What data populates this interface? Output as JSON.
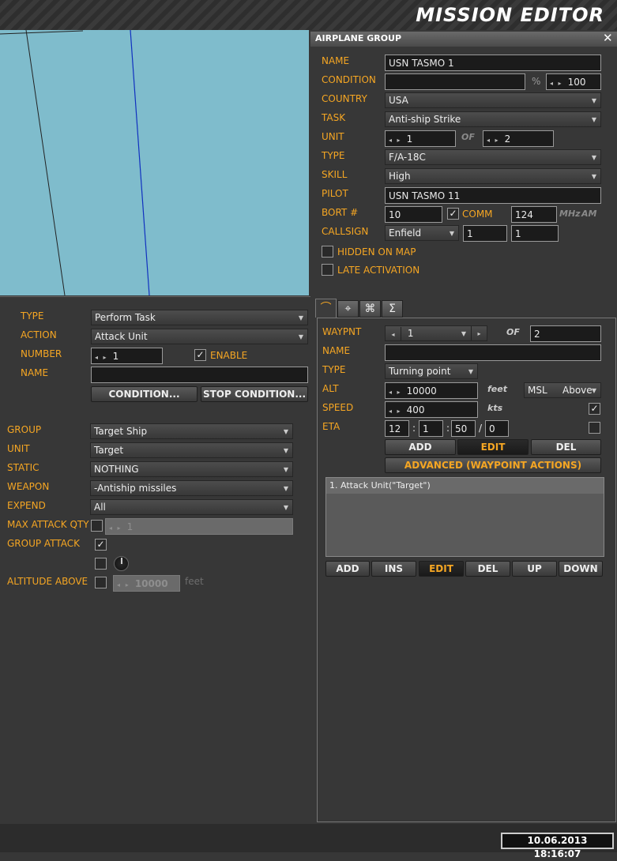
{
  "header": {
    "title": "MISSION EDITOR"
  },
  "group_panel": {
    "title": "AIRPLANE GROUP",
    "name_label": "NAME",
    "name_value": "USN TASMO 1",
    "condition_label": "CONDITION",
    "condition_value": "",
    "condition_pct_symbol": "%",
    "condition_pct": "100",
    "country_label": "COUNTRY",
    "country_value": "USA",
    "task_label": "TASK",
    "task_value": "Anti-ship Strike",
    "unit_label": "UNIT",
    "unit_value": "1",
    "unit_of": "OF",
    "unit_total": "2",
    "type_label": "TYPE",
    "type_value": "F/A-18C",
    "skill_label": "SKILL",
    "skill_value": "High",
    "pilot_label": "PILOT",
    "pilot_value": "USN TASMO 11",
    "bort_label": "BORT #",
    "bort_value": "10",
    "comm_label": "COMM",
    "comm_checked": true,
    "comm_value": "124",
    "comm_unit": "MHz",
    "comm_mod": "AM",
    "callsign_label": "CALLSIGN",
    "callsign_value": "Enfield",
    "callsign_n1": "1",
    "callsign_n2": "1",
    "hidden_label": "HIDDEN ON MAP",
    "late_label": "LATE ACTIVATION"
  },
  "tabs": [
    {
      "icon": "route-icon"
    },
    {
      "icon": "target-icon"
    },
    {
      "icon": "command-icon"
    },
    {
      "icon": "sigma-icon"
    }
  ],
  "waypoint": {
    "waypnt_label": "WAYPNT",
    "waypnt_value": "1",
    "of_label": "OF",
    "of_value": "2",
    "name_label": "NAME",
    "name_value": "",
    "type_label": "TYPE",
    "type_value": "Turning point",
    "alt_label": "ALT",
    "alt_value": "10000",
    "alt_unit": "feet",
    "alt_ref": "MSL",
    "alt_mode": "Above",
    "speed_label": "SPEED",
    "speed_value": "400",
    "speed_unit": "kts",
    "speed_checked": true,
    "eta_label": "ETA",
    "eta_h": "12",
    "eta_sep1": ":",
    "eta_m": "1",
    "eta_sep2": ":",
    "eta_s": "50",
    "eta_sep3": "/",
    "eta_d": "0",
    "eta_checked": false,
    "add": "ADD",
    "edit": "EDIT",
    "del": "DEL",
    "advanced": "ADVANCED (WAYPOINT ACTIONS)",
    "actions": [
      "1. Attack Unit(\"Target\")"
    ],
    "list_buttons": [
      "ADD",
      "INS",
      "EDIT",
      "DEL",
      "UP",
      "DOWN"
    ]
  },
  "action_panel": {
    "type_label": "TYPE",
    "type_value": "Perform Task",
    "action_label": "ACTION",
    "action_value": "Attack Unit",
    "number_label": "NUMBER",
    "number_value": "1",
    "enable_label": "ENABLE",
    "enable_checked": true,
    "name_label": "NAME",
    "name_value": "",
    "condition_btn": "CONDITION...",
    "stop_condition_btn": "STOP CONDITION...",
    "group_label": "GROUP",
    "group_value": "Target Ship",
    "unit_label": "UNIT",
    "unit_value": "Target",
    "static_label": "STATIC",
    "static_value": "NOTHING",
    "weapon_label": "WEAPON",
    "weapon_value": "-Antiship missiles",
    "expend_label": "EXPEND",
    "expend_value": "All",
    "max_attack_label": "MAX ATTACK QTY",
    "max_attack_value": "1",
    "group_attack_label": "GROUP ATTACK",
    "group_attack_checked": true,
    "altitude_label": "ALTITUDE ABOVE",
    "altitude_value": "10000",
    "altitude_unit": "feet"
  },
  "status": {
    "datetime": "10.06.2013 18:16:07"
  }
}
